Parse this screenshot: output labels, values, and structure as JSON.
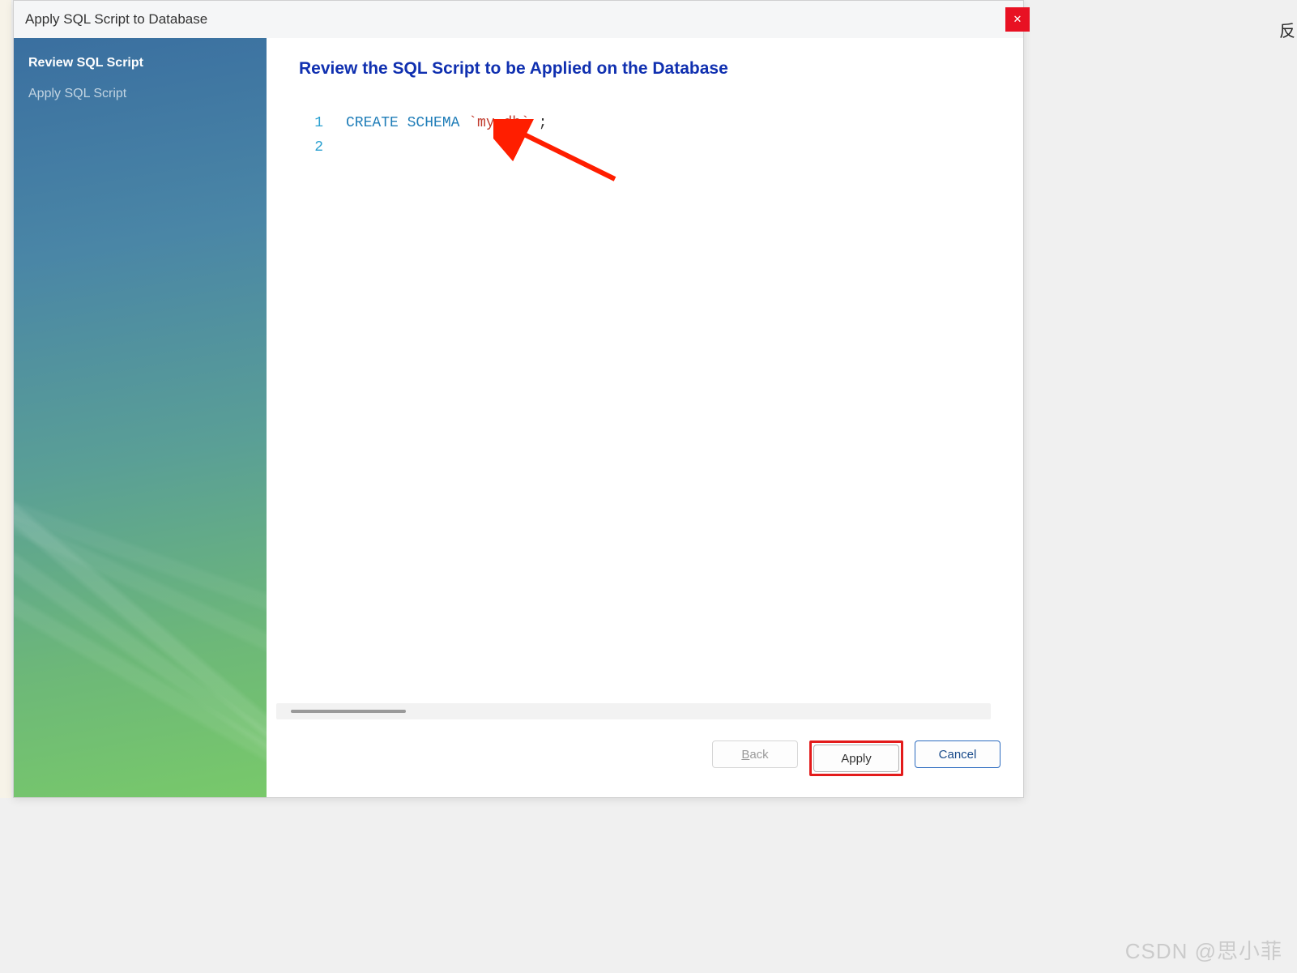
{
  "title": "Apply SQL Script to Database",
  "sidebar": {
    "items": [
      {
        "label": "Review SQL Script",
        "active": true
      },
      {
        "label": "Apply SQL Script",
        "active": false
      }
    ]
  },
  "heading": "Review the SQL Script to be Applied on the Database",
  "code": {
    "lines": [
      {
        "n": "1",
        "tokens": [
          {
            "cls": "kw",
            "t": "CREATE SCHEMA "
          },
          {
            "cls": "str",
            "t": "`my_db`"
          },
          {
            "cls": "plain",
            "t": " ;"
          }
        ]
      },
      {
        "n": "2",
        "tokens": []
      }
    ]
  },
  "buttons": {
    "back": "Back",
    "apply": "Apply",
    "cancel": "Cancel"
  },
  "watermark": "CSDN @思小菲",
  "side_char": "反"
}
